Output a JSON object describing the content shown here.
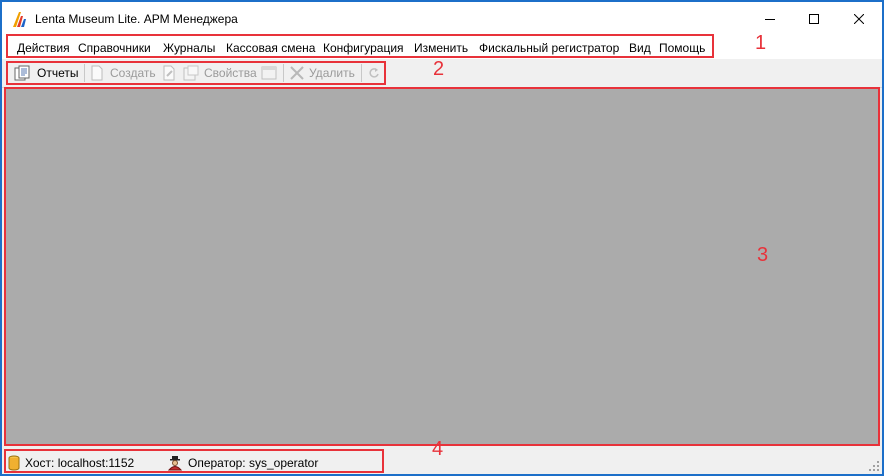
{
  "window": {
    "title": "Lenta Museum Lite. АРМ Менеджера",
    "controls": {
      "minimize": "minimize-icon",
      "maximize": "maximize-icon",
      "close": "close-icon"
    }
  },
  "menu": {
    "items": [
      {
        "label": "Действия"
      },
      {
        "label": "Справочники"
      },
      {
        "label": "Журналы"
      },
      {
        "label": "Кассовая смена"
      },
      {
        "label": "Конфигурация"
      },
      {
        "label": "Изменить"
      },
      {
        "label": "Фискальный регистратор"
      },
      {
        "label": "Вид"
      },
      {
        "label": "Помощь"
      }
    ]
  },
  "toolbar": {
    "reports_label": "Отчеты",
    "create_label": "Создать",
    "properties_label": "Свойства",
    "delete_label": "Удалить"
  },
  "status": {
    "host": "Хост: localhost:1152",
    "operator": "Оператор: sys_operator"
  },
  "annotations": [
    "1",
    "2",
    "3",
    "4"
  ],
  "colors": {
    "window_border": "#1c6fc9",
    "workspace": "#ababab",
    "annotation": "#e8323a"
  }
}
